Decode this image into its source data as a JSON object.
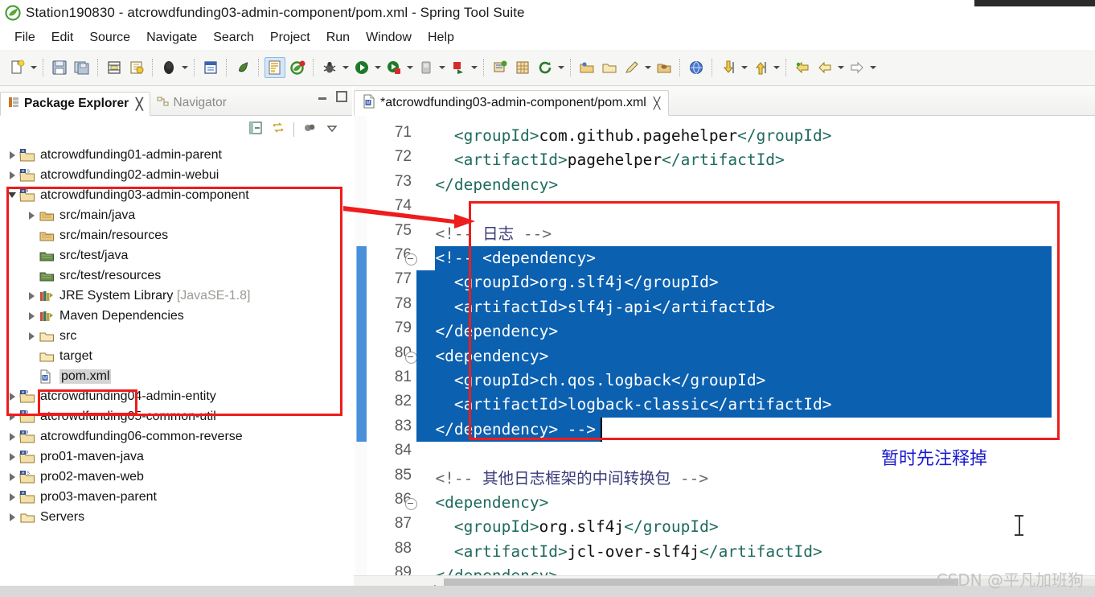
{
  "window": {
    "title": "Station190830 - atcrowdfunding03-admin-component/pom.xml - Spring Tool Suite",
    "app_icon": "sts-leaf-icon"
  },
  "menubar": {
    "items": [
      {
        "label": "File"
      },
      {
        "label": "Edit"
      },
      {
        "label": "Source"
      },
      {
        "label": "Navigate"
      },
      {
        "label": "Search"
      },
      {
        "label": "Project"
      },
      {
        "label": "Run"
      },
      {
        "label": "Window"
      },
      {
        "label": "Help"
      }
    ]
  },
  "toolbar": {
    "buttons": [
      {
        "name": "new-wizard",
        "icon": "new-file-icon",
        "dropdown": true
      },
      {
        "name": "save",
        "icon": "save-icon",
        "dropdown": false
      },
      {
        "name": "save-all",
        "icon": "save-all-icon",
        "dropdown": false
      },
      {
        "name": "print",
        "icon": "print-icon",
        "dropdown": false
      },
      {
        "name": "build-all",
        "icon": "build-icon",
        "dropdown": false
      },
      {
        "name": "open-type",
        "icon": "open-type-icon",
        "dropdown": true
      },
      {
        "name": "new-java-class",
        "icon": "java-class-icon",
        "dropdown": false
      },
      {
        "name": "new-java-package",
        "icon": "java-package-icon",
        "dropdown": false
      },
      {
        "name": "spring-boot-dashboard",
        "icon": "boot-dashboard-icon",
        "dropdown": false
      },
      {
        "name": "toggle-mark-occurrences",
        "icon": "mark-occurrences-icon",
        "dropdown": false,
        "active": true
      },
      {
        "name": "spring-explorer",
        "icon": "spring-leaf-icon",
        "dropdown": false
      },
      {
        "name": "debug",
        "icon": "debug-bug-icon",
        "dropdown": true
      },
      {
        "name": "run",
        "icon": "run-play-icon",
        "dropdown": true
      },
      {
        "name": "run-as-server",
        "icon": "run-server-icon",
        "dropdown": true
      },
      {
        "name": "coverage",
        "icon": "coverage-icon",
        "dropdown": true
      },
      {
        "name": "external-tools",
        "icon": "external-tools-icon",
        "dropdown": true
      },
      {
        "name": "new-spring-project",
        "icon": "new-spring-icon",
        "dropdown": false
      },
      {
        "name": "new-package-grid",
        "icon": "package-grid-icon",
        "dropdown": false
      },
      {
        "name": "refresh-maven",
        "icon": "maven-refresh-icon",
        "dropdown": true
      },
      {
        "name": "open-perspective",
        "icon": "open-folder-icon",
        "dropdown": false
      },
      {
        "name": "close-perspective",
        "icon": "closed-folder-icon",
        "dropdown": false
      },
      {
        "name": "pin-editor",
        "icon": "pencil-icon",
        "dropdown": true
      },
      {
        "name": "open-resource",
        "icon": "resource-folder-icon",
        "dropdown": false
      },
      {
        "name": "open-web-browser",
        "icon": "globe-icon",
        "dropdown": false
      },
      {
        "name": "download-update",
        "icon": "download-arrow-icon",
        "dropdown": true
      },
      {
        "name": "upload",
        "icon": "upload-arrow-icon",
        "dropdown": true
      },
      {
        "name": "back",
        "icon": "back-arrow-icon",
        "dropdown": false
      },
      {
        "name": "forward",
        "icon": "forward-arrow-icon",
        "dropdown": true
      },
      {
        "name": "next-annotation",
        "icon": "next-arrow-icon",
        "dropdown": true
      }
    ]
  },
  "left_panel": {
    "tabs": [
      {
        "label": "Package Explorer",
        "selected": true,
        "icon": "package-explorer-icon",
        "close": "╳"
      },
      {
        "label": "Navigator",
        "selected": false,
        "icon": "navigator-icon"
      }
    ],
    "window_controls": [
      {
        "name": "minimize-view-button",
        "icon": "minimize-icon"
      },
      {
        "name": "maximize-view-button",
        "icon": "maximize-icon"
      }
    ],
    "view_toolbar": [
      {
        "name": "collapse-all-button",
        "icon": "collapse-all-icon"
      },
      {
        "name": "link-with-editor-button",
        "icon": "link-editor-icon"
      },
      {
        "name": "view-menu-focus-button",
        "icon": "focus-icon"
      },
      {
        "name": "view-menu-button",
        "icon": "chevron-down-icon"
      }
    ],
    "tree": [
      {
        "label": "atcrowdfunding01-admin-parent",
        "indent": 0,
        "twisty": "closed",
        "icon": "maven-project-icon",
        "selected": false
      },
      {
        "label": "atcrowdfunding02-admin-webui",
        "indent": 0,
        "twisty": "closed",
        "icon": "maven-web-project-icon",
        "selected": false
      },
      {
        "label": "atcrowdfunding03-admin-component",
        "indent": 0,
        "twisty": "open",
        "icon": "maven-java-project-icon",
        "selected": false
      },
      {
        "label": "src/main/java",
        "indent": 1,
        "twisty": "closed",
        "icon": "source-folder-icon",
        "selected": false
      },
      {
        "label": "src/main/resources",
        "indent": 1,
        "twisty": "none",
        "icon": "source-folder-icon",
        "selected": false
      },
      {
        "label": "src/test/java",
        "indent": 1,
        "twisty": "none",
        "icon": "source-folder-dark-icon",
        "selected": false
      },
      {
        "label": "src/test/resources",
        "indent": 1,
        "twisty": "none",
        "icon": "source-folder-dark-icon",
        "selected": false
      },
      {
        "label": "JRE System Library",
        "suffix": " [JavaSE-1.8]",
        "indent": 1,
        "twisty": "closed",
        "icon": "library-icon",
        "selected": false
      },
      {
        "label": "Maven Dependencies",
        "indent": 1,
        "twisty": "closed",
        "icon": "library-icon",
        "selected": false
      },
      {
        "label": "src",
        "indent": 1,
        "twisty": "closed",
        "icon": "folder-icon",
        "selected": false
      },
      {
        "label": "target",
        "indent": 1,
        "twisty": "none",
        "icon": "folder-icon",
        "selected": false
      },
      {
        "label": "pom.xml",
        "indent": 1,
        "twisty": "none",
        "icon": "maven-pom-icon",
        "selected": true
      },
      {
        "label": "atcrowdfunding04-admin-entity",
        "indent": 0,
        "twisty": "closed",
        "icon": "maven-java-project-icon",
        "selected": false
      },
      {
        "label": "atcrowdfunding05-common-util",
        "indent": 0,
        "twisty": "closed",
        "icon": "maven-java-project-icon",
        "selected": false
      },
      {
        "label": "atcrowdfunding06-common-reverse",
        "indent": 0,
        "twisty": "closed",
        "icon": "maven-java-project-icon",
        "selected": false
      },
      {
        "label": "pro01-maven-java",
        "indent": 0,
        "twisty": "closed",
        "icon": "maven-java-project-icon",
        "selected": false
      },
      {
        "label": "pro02-maven-web",
        "indent": 0,
        "twisty": "closed",
        "icon": "maven-web-project-icon",
        "selected": false
      },
      {
        "label": "pro03-maven-parent",
        "indent": 0,
        "twisty": "closed",
        "icon": "maven-project-icon",
        "selected": false
      },
      {
        "label": "Servers",
        "indent": 0,
        "twisty": "closed",
        "icon": "folder-icon",
        "selected": false
      }
    ]
  },
  "editor": {
    "tab": {
      "label": "*atcrowdfunding03-admin-component/pom.xml",
      "icon": "maven-pom-icon",
      "close": "╳",
      "dirty": true
    },
    "first_line": 71,
    "lines": [
      {
        "n": 71,
        "fold": false,
        "indent": 4,
        "segments": [
          {
            "t": "tag",
            "s": "<groupId>"
          },
          {
            "t": "txt",
            "s": "com.github.pagehelper"
          },
          {
            "t": "tag",
            "s": "</groupId>"
          }
        ]
      },
      {
        "n": 72,
        "fold": false,
        "indent": 4,
        "segments": [
          {
            "t": "tag",
            "s": "<artifactId>"
          },
          {
            "t": "txt",
            "s": "pagehelper"
          },
          {
            "t": "tag",
            "s": "</artifactId>"
          }
        ]
      },
      {
        "n": 73,
        "fold": false,
        "indent": 2,
        "segments": [
          {
            "t": "tag",
            "s": "</dependency>"
          }
        ]
      },
      {
        "n": 74,
        "fold": false,
        "indent": 0,
        "segments": []
      },
      {
        "n": 75,
        "fold": false,
        "indent": 2,
        "segments": [
          {
            "t": "cmt",
            "s": "<!-- "
          },
          {
            "t": "cmt-cn",
            "s": "日志"
          },
          {
            "t": "cmt",
            "s": " -->"
          }
        ]
      },
      {
        "n": 76,
        "fold": true,
        "indent": 2,
        "selected": true,
        "segments": [
          {
            "t": "cmt",
            "s": "<!-- <dependency>"
          }
        ]
      },
      {
        "n": 77,
        "fold": false,
        "indent": 4,
        "selected": true,
        "segments": [
          {
            "t": "cmt",
            "s": "<groupId>org.slf4j</groupId>"
          }
        ]
      },
      {
        "n": 78,
        "fold": false,
        "indent": 4,
        "selected": true,
        "segments": [
          {
            "t": "cmt",
            "s": "<artifactId>slf4j-api</artifactId>"
          }
        ]
      },
      {
        "n": 79,
        "fold": false,
        "indent": 2,
        "selected": true,
        "segments": [
          {
            "t": "cmt",
            "s": "</dependency>"
          }
        ]
      },
      {
        "n": 80,
        "fold": true,
        "indent": 2,
        "selected": true,
        "segments": [
          {
            "t": "cmt",
            "s": "<dependency>"
          }
        ]
      },
      {
        "n": 81,
        "fold": false,
        "indent": 4,
        "selected": true,
        "segments": [
          {
            "t": "cmt",
            "s": "<groupId>ch.qos.logback</groupId>"
          }
        ]
      },
      {
        "n": 82,
        "fold": false,
        "indent": 4,
        "selected": true,
        "segments": [
          {
            "t": "cmt",
            "s": "<artifactId>logback-classic</artifactId>"
          }
        ]
      },
      {
        "n": 83,
        "fold": false,
        "indent": 2,
        "selected": true,
        "segments": [
          {
            "t": "cmt",
            "s": "</dependency> -->"
          }
        ]
      },
      {
        "n": 84,
        "fold": false,
        "indent": 0,
        "segments": []
      },
      {
        "n": 85,
        "fold": false,
        "indent": 2,
        "segments": [
          {
            "t": "cmt",
            "s": "<!-- "
          },
          {
            "t": "cmt-cn",
            "s": "其他日志框架的中间转换包"
          },
          {
            "t": "cmt",
            "s": " -->"
          }
        ]
      },
      {
        "n": 86,
        "fold": true,
        "indent": 2,
        "segments": [
          {
            "t": "tag",
            "s": "<dependency>"
          }
        ]
      },
      {
        "n": 87,
        "fold": false,
        "indent": 4,
        "segments": [
          {
            "t": "tag",
            "s": "<groupId>"
          },
          {
            "t": "txt",
            "s": "org.slf4j"
          },
          {
            "t": "tag",
            "s": "</groupId>"
          }
        ]
      },
      {
        "n": 88,
        "fold": false,
        "indent": 4,
        "segments": [
          {
            "t": "tag",
            "s": "<artifactId>"
          },
          {
            "t": "txt",
            "s": "jcl-over-slf4j"
          },
          {
            "t": "tag",
            "s": "</artifactId>"
          }
        ]
      },
      {
        "n": 89,
        "fold": false,
        "indent": 2,
        "segments": [
          {
            "t": "tag",
            "s": "</dependency>"
          }
        ]
      }
    ],
    "scrollbar": {
      "left_arrow": "‹"
    }
  },
  "annotations": {
    "note_text": "暂时先注释掉",
    "note_color": "#1a1ad0",
    "box_color": "#ee1c1c",
    "arrow_color": "#ee1c1c"
  },
  "watermark": {
    "text": "CSDN @平凡加班狗"
  },
  "colors": {
    "selection_blue": "#0b60b0",
    "toolbar_bg": "#f6f6f4",
    "tag_green": "#1f6b5e",
    "comment_gray": "#6a6a6a",
    "comment_cn": "#3b3b7a"
  }
}
